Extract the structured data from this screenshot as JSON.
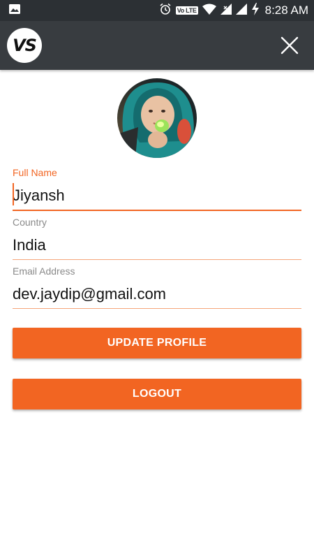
{
  "status_bar": {
    "time": "8:28 AM",
    "volte_label": "Vo LTE",
    "icons": [
      "image-icon",
      "alarm-icon",
      "volte-icon",
      "wifi-icon",
      "signal-icon",
      "signal-icon",
      "charging-icon"
    ]
  },
  "app_bar": {
    "logo_text": "VS",
    "close_icon": "close-icon"
  },
  "profile": {
    "avatar": "avatar"
  },
  "form": {
    "full_name": {
      "label": "Full Name",
      "value": "Jiyansh"
    },
    "country": {
      "label": "Country",
      "value": "India"
    },
    "email": {
      "label": "Email Address",
      "value": "dev.jaydip@gmail.com"
    }
  },
  "buttons": {
    "update_label": "UPDATE PROFILE",
    "logout_label": "LOGOUT"
  },
  "colors": {
    "accent": "#f26522",
    "status_bar": "#2c3034",
    "app_bar": "#383c40"
  }
}
